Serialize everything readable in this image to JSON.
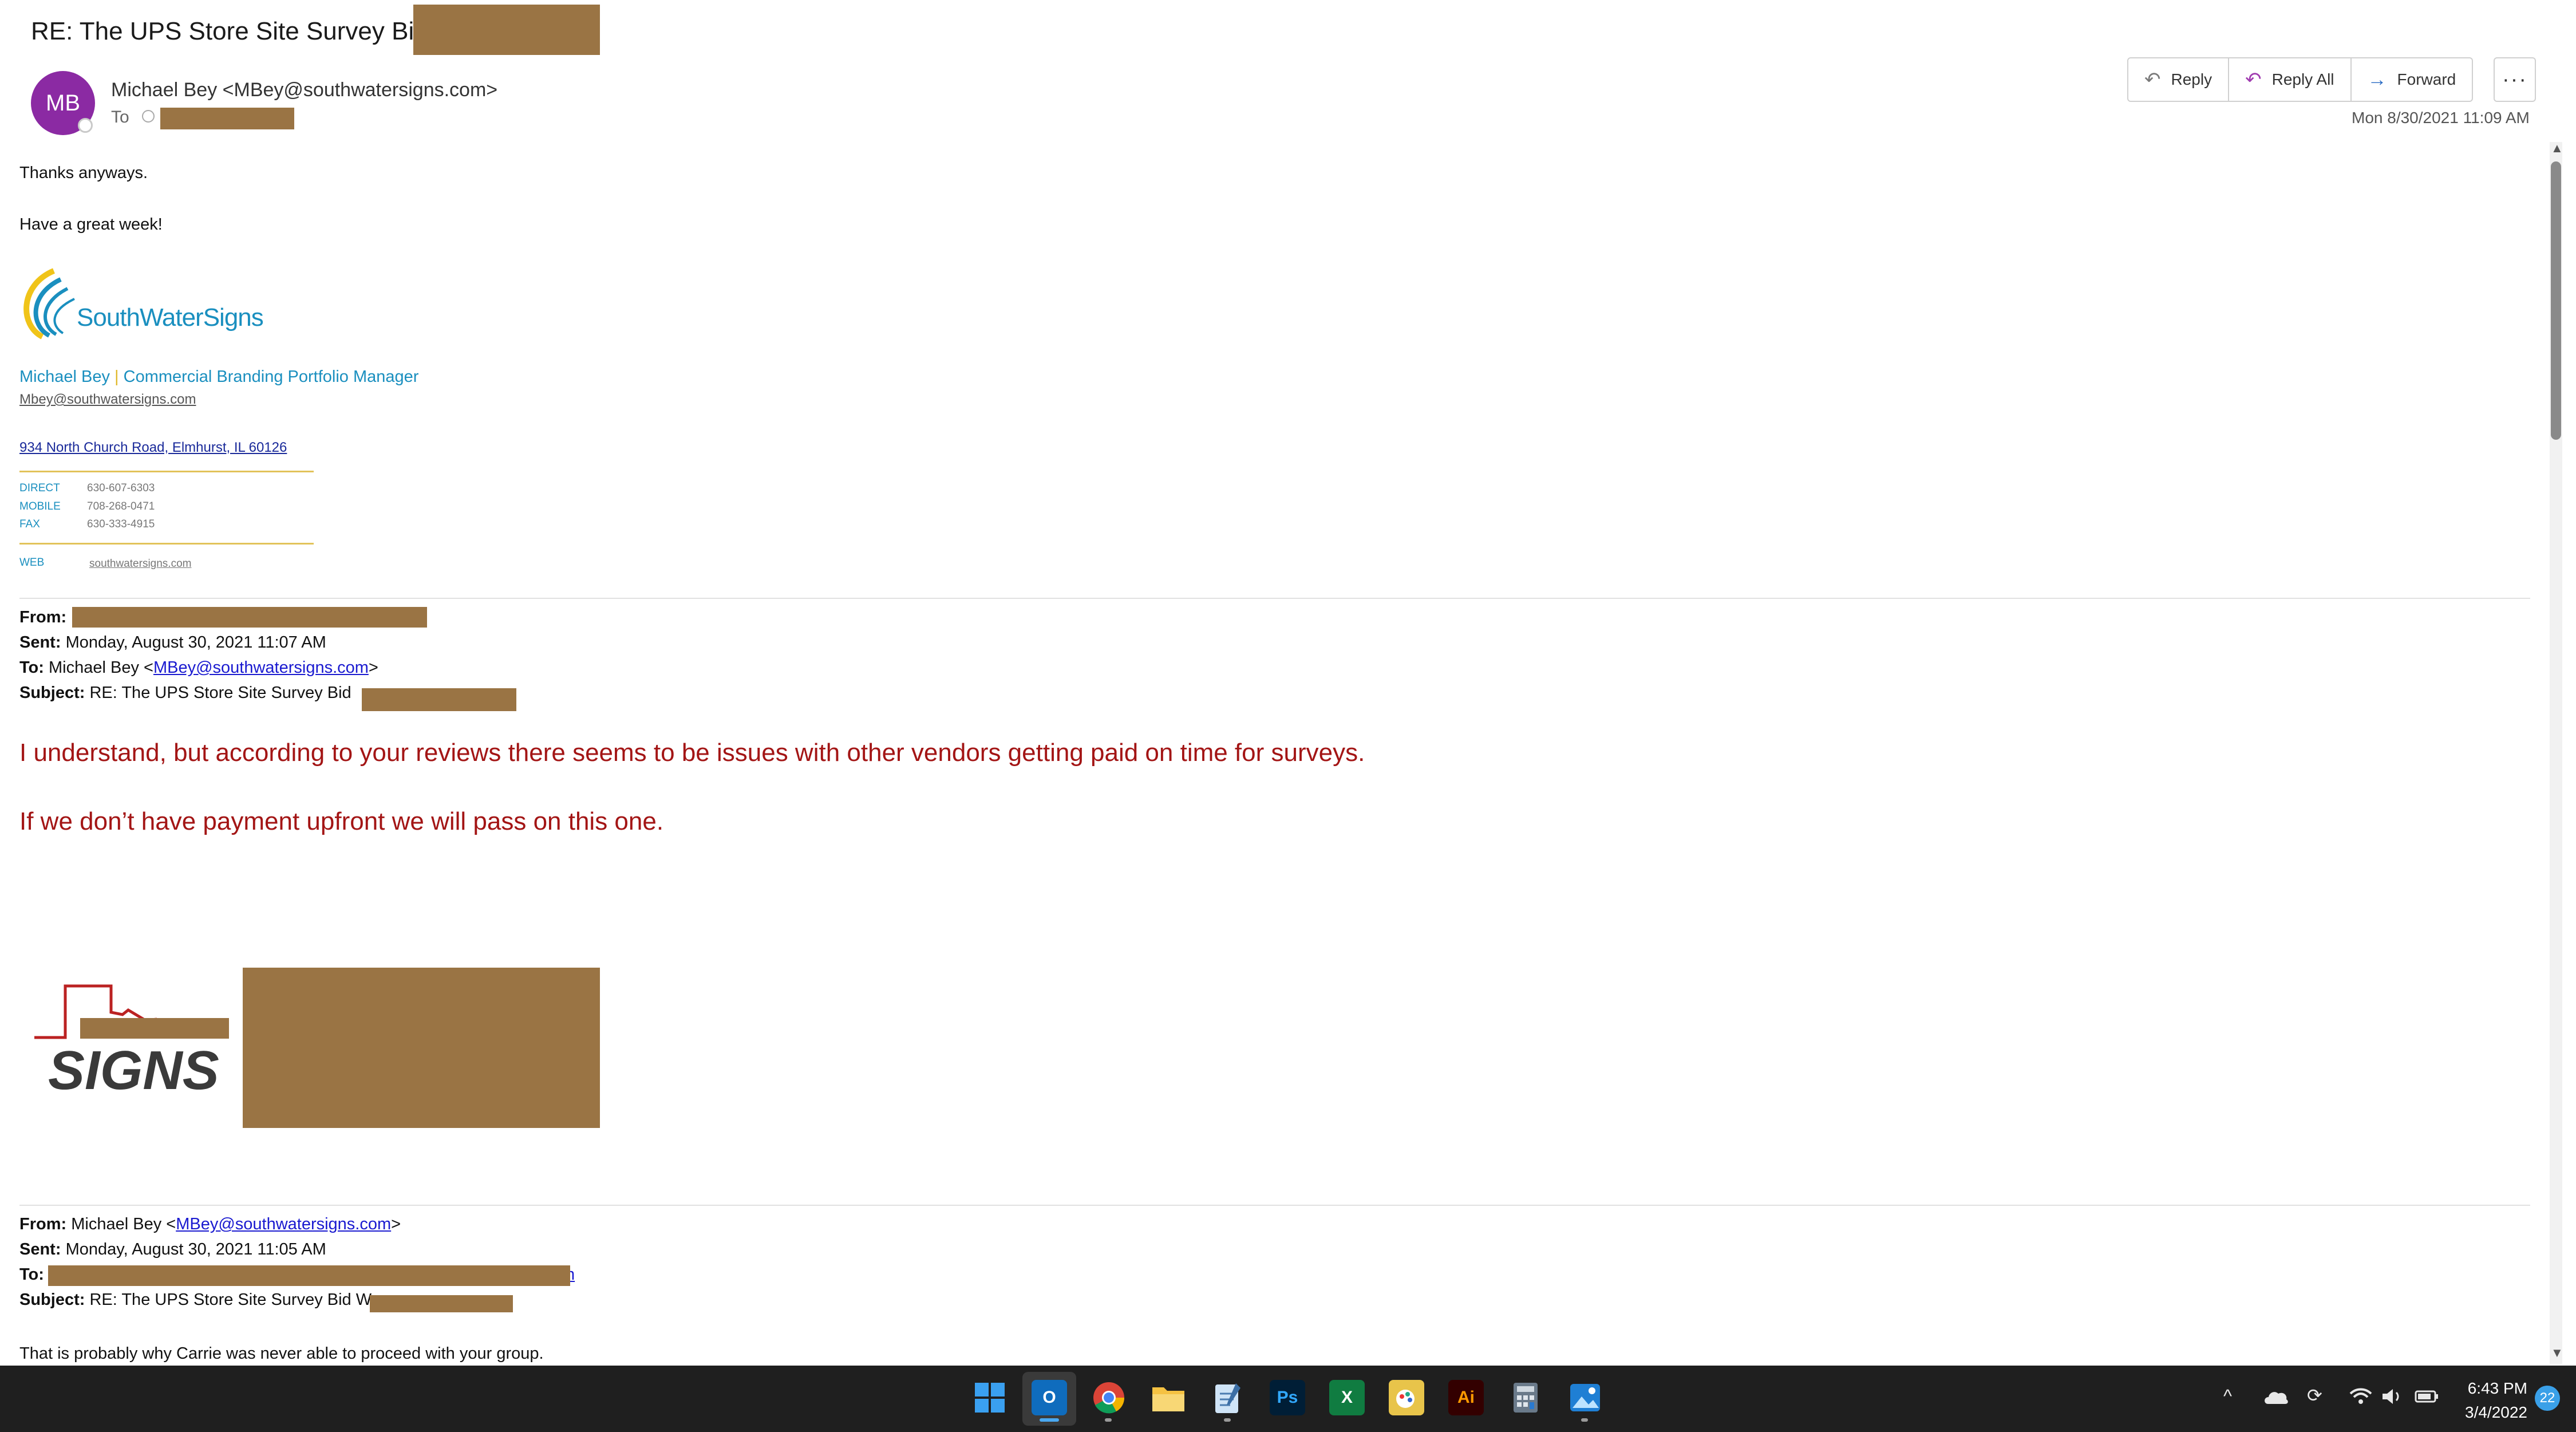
{
  "email": {
    "subject": "RE: The UPS Store Site Survey Bid W",
    "avatar_initials": "MB",
    "sender": "Michael Bey <MBey@southwatersigns.com>",
    "to_label": "To",
    "date": "Mon 8/30/2021 11:09 AM"
  },
  "actions": {
    "reply": "Reply",
    "reply_all": "Reply All",
    "forward": "Forward",
    "more": "···"
  },
  "body": {
    "line1": "Thanks anyways.",
    "line2": "Have a great week!"
  },
  "signature": {
    "logo_text": "SouthWaterSigns",
    "name": "Michael Bey",
    "separator": "|",
    "title": "Commercial Branding Portfolio Manager",
    "email": "Mbey@southwatersigns.com",
    "address": "934 North Church Road, Elmhurst, IL 60126",
    "direct_label": "DIRECT",
    "direct": "630-607-6303",
    "mobile_label": "MOBILE",
    "mobile": "708-268-0471",
    "fax_label": "FAX",
    "fax": "630-333-4915",
    "web_label": "WEB",
    "web": "southwatersigns.com"
  },
  "quoted1": {
    "from_label": "From:",
    "sent_label": "Sent:",
    "sent": "Monday, August 30, 2021 11:07 AM",
    "to_label": "To:",
    "to_name": "Michael Bey <",
    "to_link": "MBey@southwatersigns.com",
    "to_end": ">",
    "subject_label": "Subject:",
    "subject": "RE: The UPS Store Site Survey Bid",
    "message1": "I understand, but according to your reviews there seems to be issues with other vendors getting paid on time for surveys.",
    "message2": "If we don’t have payment upfront we will pass on this one.",
    "logo_text": "SIGNS"
  },
  "quoted2": {
    "from_label": "From:",
    "from_name": "Michael Bey <",
    "from_link": "MBey@southwatersigns.com",
    "from_end": ">",
    "sent_label": "Sent:",
    "sent": "Monday, August 30, 2021 11:05 AM",
    "to_label": "To:",
    "to_tail": "n",
    "subject_label": "Subject:",
    "subject": "RE: The UPS Store Site Survey Bid W",
    "body": "That is probably why Carrie was never able to proceed with your group."
  },
  "taskbar": {
    "time": "6:43 PM",
    "date": "3/4/2022",
    "notifications": "22",
    "apps": [
      "start-icon",
      "outlook-icon",
      "chrome-icon",
      "file-explorer-icon",
      "notepad-icon",
      "photoshop-icon",
      "excel-icon",
      "paint-icon",
      "illustrator-icon",
      "calculator-icon",
      "photos-icon"
    ],
    "ps_label": "Ps",
    "ai_label": "Ai"
  }
}
